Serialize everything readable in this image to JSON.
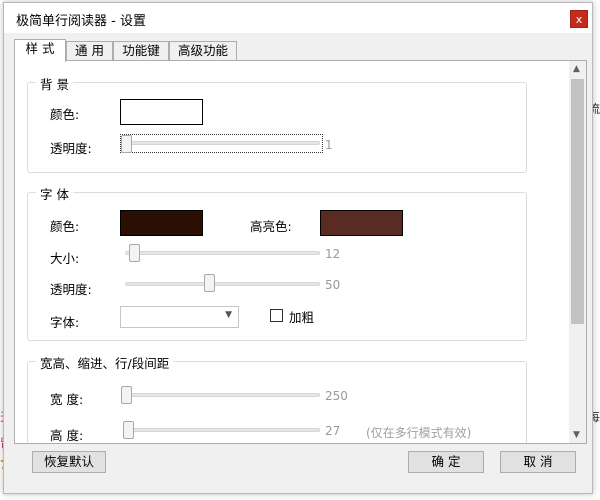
{
  "window": {
    "title": "极简单行阅读器 - 设置",
    "close_glyph": "x"
  },
  "tabs": [
    {
      "label": "样 式",
      "active": true
    },
    {
      "label": "通 用"
    },
    {
      "label": "功能键"
    },
    {
      "label": "高级功能"
    }
  ],
  "background_group": {
    "title": "背 景",
    "color_label": "颜色:",
    "color": "#ffffff",
    "opacity_label": "透明度:",
    "opacity_value": "1"
  },
  "font_group": {
    "title": "字 体",
    "color_label": "颜色:",
    "color": "#2b0e04",
    "highlight_label": "高亮色:",
    "highlight_color": "#5a2b22",
    "size_label": "大小:",
    "size_value": "12",
    "opacity_label": "透明度:",
    "opacity_value": "50",
    "font_label": "字体:",
    "font_value": "",
    "bold_label": "加粗",
    "bold_checked": false
  },
  "spacing_group": {
    "title": "宽高、缩进、行/段间距",
    "width_label": "宽 度:",
    "width_value": "250",
    "height_label": "高 度:",
    "height_value": "27",
    "height_hint": "(仅在多行模式有效)"
  },
  "buttons": {
    "reset": "恢复默认",
    "ok": "确 定",
    "cancel": "取 消"
  },
  "background_page": {
    "frag1": "流",
    "frag2": "天",
    "frag3": "留",
    "frag4": "7",
    "frag5": "每"
  }
}
